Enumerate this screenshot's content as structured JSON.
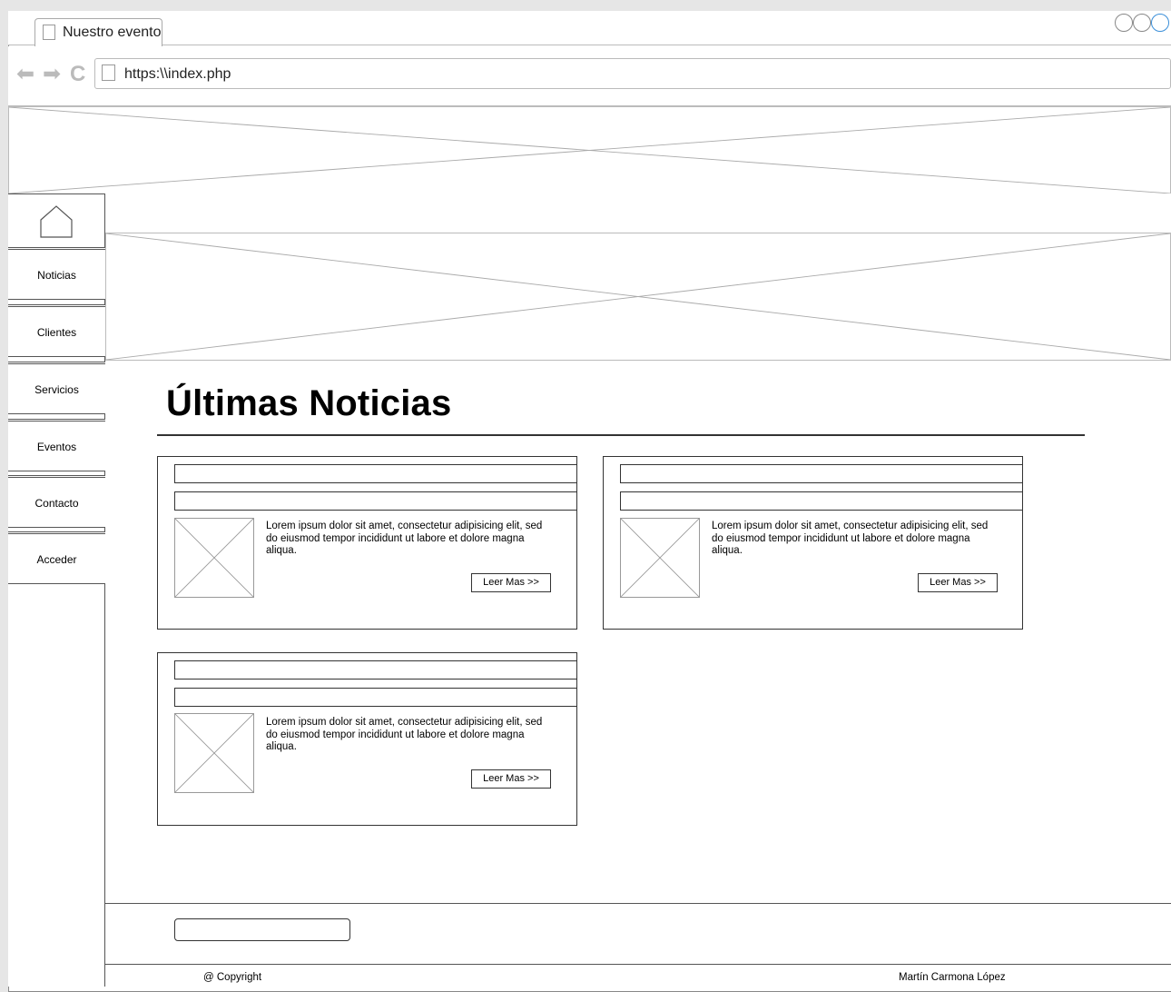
{
  "browser": {
    "tab_title": "Nuestro evento",
    "url": "https:\\\\index.php",
    "nav_icons": [
      "back-arrow-icon",
      "forward-arrow-icon",
      "refresh-icon"
    ],
    "window_controls": [
      "window-control-1",
      "window-control-2",
      "window-control-3"
    ]
  },
  "sidebar": {
    "home_icon": "home-icon",
    "items": [
      {
        "label": "Noticias"
      },
      {
        "label": "Clientes"
      },
      {
        "label": "Servicios"
      },
      {
        "label": "Eventos"
      },
      {
        "label": "Contacto"
      },
      {
        "label": "Acceder"
      }
    ]
  },
  "main": {
    "title": "Últimas Noticias",
    "cards": [
      {
        "text": "Lorem ipsum dolor sit amet, consectetur adipisicing elit, sed do eiusmod tempor incididunt ut labore et dolore magna aliqua.",
        "button": "Leer Mas >>"
      },
      {
        "text": "Lorem ipsum dolor sit amet, consectetur adipisicing elit, sed do eiusmod tempor incididunt ut labore et dolore magna aliqua.",
        "button": "Leer Mas >>"
      },
      {
        "text": "Lorem ipsum dolor sit amet, consectetur adipisicing elit, sed do eiusmod tempor incididunt ut labore et dolore magna aliqua.",
        "button": "Leer Mas >>"
      }
    ]
  },
  "footer": {
    "copyright": "@ Copyright",
    "author": "Martín Carmona López"
  },
  "colors": {
    "line": "#555555",
    "placeholder": "#bbbbbb",
    "window_control_accent": "#3b8fd9"
  }
}
